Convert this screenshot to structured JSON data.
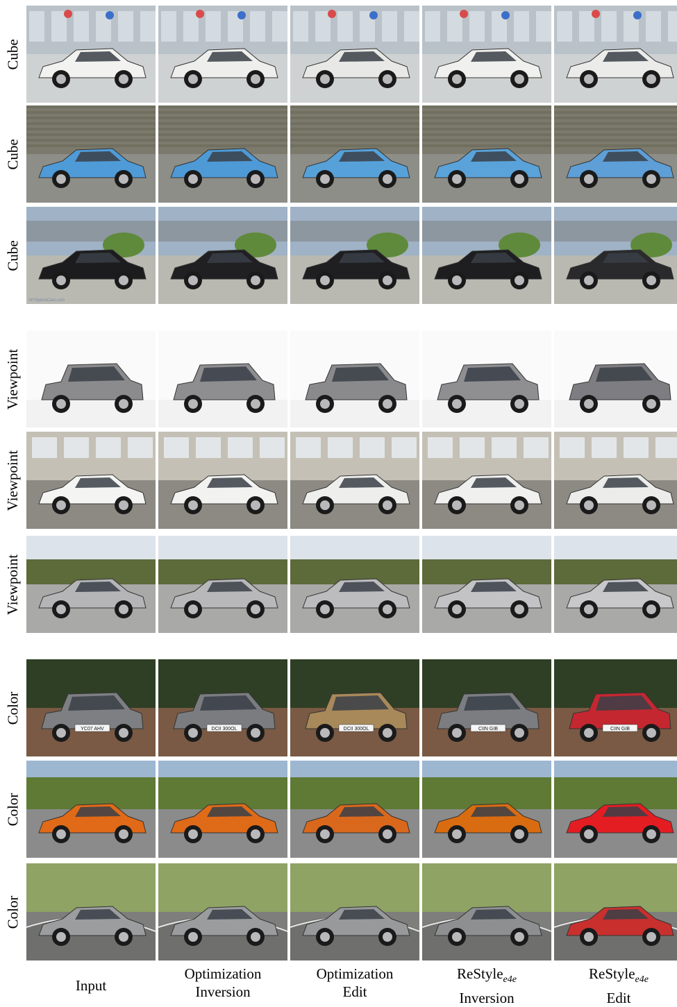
{
  "column_captions": [
    {
      "line1": "Input",
      "line1_sub": "",
      "line2": ""
    },
    {
      "line1": "Optimization",
      "line1_sub": "",
      "line2": "Inversion"
    },
    {
      "line1": "Optimization",
      "line1_sub": "",
      "line2": "Edit"
    },
    {
      "line1": "ReStyle",
      "line1_sub": "e4e",
      "line2": "Inversion"
    },
    {
      "line1": "ReStyle",
      "line1_sub": "e4e",
      "line2": "Edit"
    }
  ],
  "rows": [
    {
      "label": "Cube",
      "scene": "showroom",
      "car_colors": [
        "#f2f2f0",
        "#eeeeec",
        "#e8e8e6",
        "#f0f0ee",
        "#ebebea"
      ],
      "bg": "#b9c2c8",
      "ground": "#cfd2d2",
      "plate": "",
      "plates": []
    },
    {
      "label": "Cube",
      "scene": "wall",
      "car_colors": [
        "#4f9bd8",
        "#4e9ad6",
        "#57a1d9",
        "#5aa3da",
        "#5d9fd6"
      ],
      "bg": "#7c7a6c",
      "ground": "#8e8e88",
      "plate": "",
      "plates": []
    },
    {
      "label": "Cube",
      "scene": "dealer",
      "car_colors": [
        "#1c1c1e",
        "#202022",
        "#1f1f22",
        "#1e1e20",
        "#2a2a2c"
      ],
      "bg": "#9fb2c6",
      "ground": "#b9b9b2",
      "plate": "NYSportsCars.com",
      "plates": []
    },
    {
      "label": "Viewpoint",
      "scene": "studio",
      "car_colors": [
        "#8b8b8e",
        "#8e8e91",
        "#8a8a8d",
        "#8f8f92",
        "#7e7e82"
      ],
      "bg": "#fafafa",
      "ground": "#f2f2f2",
      "plate": "",
      "plates": []
    },
    {
      "label": "Viewpoint",
      "scene": "garage",
      "car_colors": [
        "#f4f4f2",
        "#f2f2f0",
        "#eeeeec",
        "#f0f0ee",
        "#ececea"
      ],
      "bg": "#c5c0b5",
      "ground": "#8d8a84",
      "plate": "",
      "plates": []
    },
    {
      "label": "Viewpoint",
      "scene": "lot",
      "car_colors": [
        "#b5b5b8",
        "#b8b8bb",
        "#bcbcbf",
        "#c3c3c6",
        "#c8c8cb"
      ],
      "bg": "#c9d2db",
      "ground": "#a9a9a7",
      "plate": "",
      "plates": []
    },
    {
      "label": "Color",
      "scene": "trees",
      "car_colors": [
        "#7d7f83",
        "#7a7c80",
        "#a8895a",
        "#7b7d81",
        "#c42730"
      ],
      "bg": "#3c4a30",
      "ground": "#7a5a44",
      "plate": "",
      "plates": [
        "YC07 AHV",
        "DCII 300OL",
        "DCII 300OL",
        "CIIN GIB",
        "CIIN GIB"
      ]
    },
    {
      "label": "Color",
      "scene": "field",
      "car_colors": [
        "#e06a17",
        "#df6a18",
        "#d9681d",
        "#d96c10",
        "#e41d22"
      ],
      "bg": "#7d8c48",
      "ground": "#8b8b8b",
      "plate": "",
      "plates": []
    },
    {
      "label": "Color",
      "scene": "track",
      "car_colors": [
        "#9b9d9f",
        "#9a9c9e",
        "#97999b",
        "#8d8f91",
        "#c8302e"
      ],
      "bg": "#8fa364",
      "ground": "#7e7e7c",
      "plate": "",
      "plates": []
    }
  ]
}
